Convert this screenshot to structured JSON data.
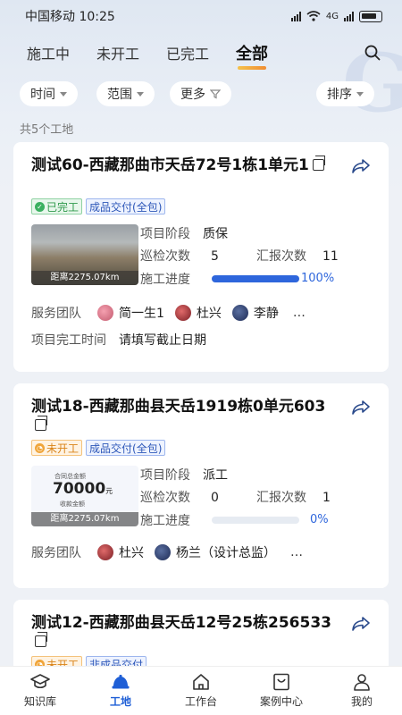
{
  "status_bar": {
    "carrier": "中国移动",
    "time": "10:25",
    "network": "4G"
  },
  "tabs": [
    {
      "label": "施工中",
      "active": false
    },
    {
      "label": "未开工",
      "active": false
    },
    {
      "label": "已完工",
      "active": false
    },
    {
      "label": "全部",
      "active": true
    }
  ],
  "filters": {
    "time": "时间",
    "range": "范围",
    "more": "更多",
    "sort": "排序"
  },
  "site_count": "共5个工地",
  "projects": [
    {
      "title": "测试60-西藏那曲市天岳72号1栋1单元1",
      "status": "已完工",
      "type": "成品交付(全包)",
      "distance": "距离2275.07km",
      "stage_label": "项目阶段",
      "stage": "质保",
      "inspect_label": "巡检次数",
      "inspect": "5",
      "report_label": "汇报次数",
      "report": "11",
      "progress_label": "施工进度",
      "progress": 100,
      "progress_text": "100%",
      "team_label": "服务团队",
      "team": [
        "简一生1",
        "杜兴",
        "李静"
      ],
      "finish_label": "项目完工时间",
      "finish_value": "请填写截止日期"
    },
    {
      "title": "测试18-西藏那曲县天岳1919栋0单元603",
      "status": "未开工",
      "type": "成品交付(全包)",
      "distance": "距离2275.07km",
      "thumb_caption": "合同总金额",
      "thumb_amount": "70000",
      "thumb_unit": "元",
      "thumb_caption2": "收款金额",
      "stage_label": "项目阶段",
      "stage": "派工",
      "inspect_label": "巡检次数",
      "inspect": "0",
      "report_label": "汇报次数",
      "report": "1",
      "progress_label": "施工进度",
      "progress": 0,
      "progress_text": "0%",
      "team_label": "服务团队",
      "team": [
        "杜兴",
        "杨兰（设计总监）"
      ]
    },
    {
      "title": "测试12-西藏那曲县天岳12号25栋256533",
      "status": "未开工",
      "type": "非成品交付"
    }
  ],
  "bottom_nav": [
    {
      "label": "知识库",
      "active": false
    },
    {
      "label": "工地",
      "active": true
    },
    {
      "label": "工作台",
      "active": false
    },
    {
      "label": "案例中心",
      "active": false
    },
    {
      "label": "我的",
      "active": false
    }
  ],
  "colors": {
    "accent": "#1f5fd6",
    "progress": "#2e66dc",
    "done": "#2f9a4c",
    "pending": "#d98318"
  }
}
